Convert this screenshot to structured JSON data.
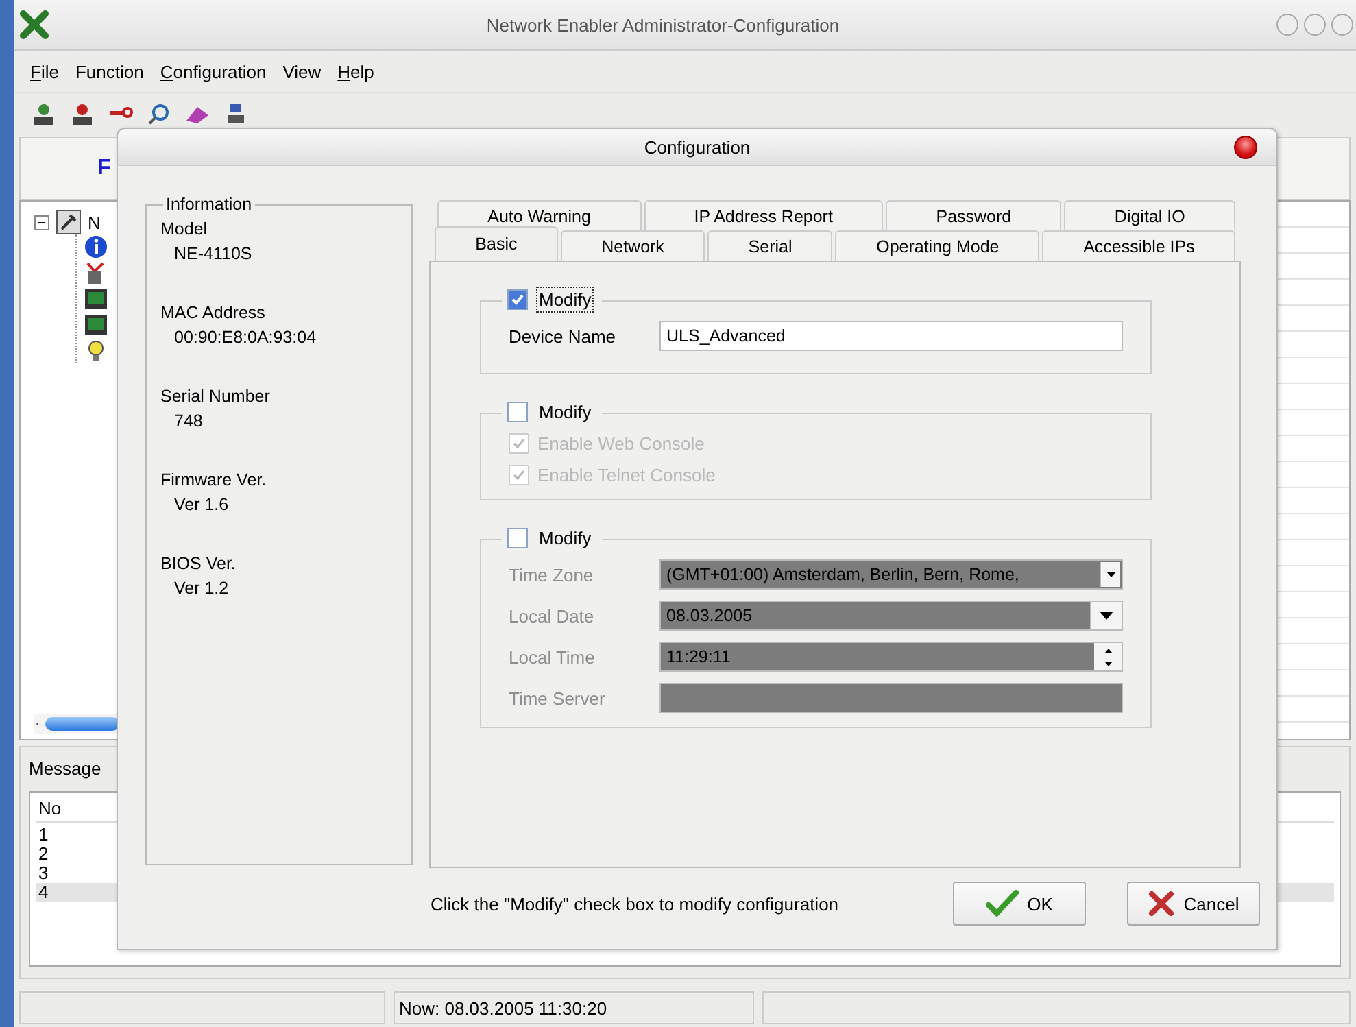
{
  "window": {
    "title": "Network Enabler Administrator-Configuration"
  },
  "menu": [
    {
      "label": "File",
      "mnemonic": true
    },
    {
      "label": "Function",
      "mnemonic": false
    },
    {
      "label": "Configuration",
      "mnemonic": true
    },
    {
      "label": "View",
      "mnemonic": false
    },
    {
      "label": "Help",
      "mnemonic": true
    }
  ],
  "panel_header": {
    "text": "F"
  },
  "tree": {
    "label": "N",
    "expanded": true
  },
  "messages": {
    "title": "Message",
    "columns": [
      "No"
    ],
    "rows": [
      {
        "no": "1",
        "selected": false
      },
      {
        "no": "2",
        "selected": false
      },
      {
        "no": "3",
        "selected": false
      },
      {
        "no": "4",
        "selected": true
      }
    ]
  },
  "status_bar": {
    "text": "Now: 08.03.2005 11:30:20"
  },
  "dialog": {
    "title": "Configuration",
    "info": {
      "heading": "Information",
      "fields": [
        {
          "label": "Model",
          "value": "NE-4110S"
        },
        {
          "label": "MAC Address",
          "value": "00:90:E8:0A:93:04"
        },
        {
          "label": "Serial Number",
          "value": "748"
        },
        {
          "label": "Firmware Ver.",
          "value": "Ver 1.6"
        },
        {
          "label": "BIOS Ver.",
          "value": "Ver 1.2"
        }
      ]
    },
    "tab_rows": [
      [
        {
          "label": "Auto Warning",
          "selected": false
        },
        {
          "label": "IP Address Report",
          "selected": false
        },
        {
          "label": "Password",
          "selected": false
        },
        {
          "label": "Digital IO",
          "selected": false
        }
      ],
      [
        {
          "label": "Basic",
          "selected": true
        },
        {
          "label": "Network",
          "selected": false
        },
        {
          "label": "Serial",
          "selected": false
        },
        {
          "label": "Operating Mode",
          "selected": false
        },
        {
          "label": "Accessible IPs",
          "selected": false
        }
      ]
    ],
    "groups": [
      {
        "modify": {
          "label": "Modify",
          "checked": true,
          "focused": true
        },
        "fields": [
          {
            "kind": "text",
            "label": "Device Name",
            "value": "ULS_Advanced",
            "disabled": false
          }
        ]
      },
      {
        "modify": {
          "label": "Modify",
          "checked": false,
          "focused": false
        },
        "options": [
          {
            "label": "Enable Web Console",
            "checked": true,
            "disabled": true
          },
          {
            "label": "Enable Telnet Console",
            "checked": true,
            "disabled": true
          }
        ]
      },
      {
        "modify": {
          "label": "Modify",
          "checked": false,
          "focused": false
        },
        "fields": [
          {
            "kind": "dropdown",
            "label": "Time Zone",
            "value": "(GMT+01:00) Amsterdam, Berlin, Bern, Rome,",
            "disabled": true
          },
          {
            "kind": "date",
            "label": "Local Date",
            "value": "08.03.2005",
            "disabled": true
          },
          {
            "kind": "spin",
            "label": "Local Time",
            "value": "11:29:11",
            "disabled": true
          },
          {
            "kind": "text",
            "label": "Time Server",
            "disabled": true
          }
        ]
      }
    ],
    "hint": "Click the \"Modify\" check box to modify configuration",
    "buttons": [
      {
        "kind": "ok",
        "label": "OK"
      },
      {
        "kind": "cancel",
        "label": "Cancel"
      }
    ]
  }
}
